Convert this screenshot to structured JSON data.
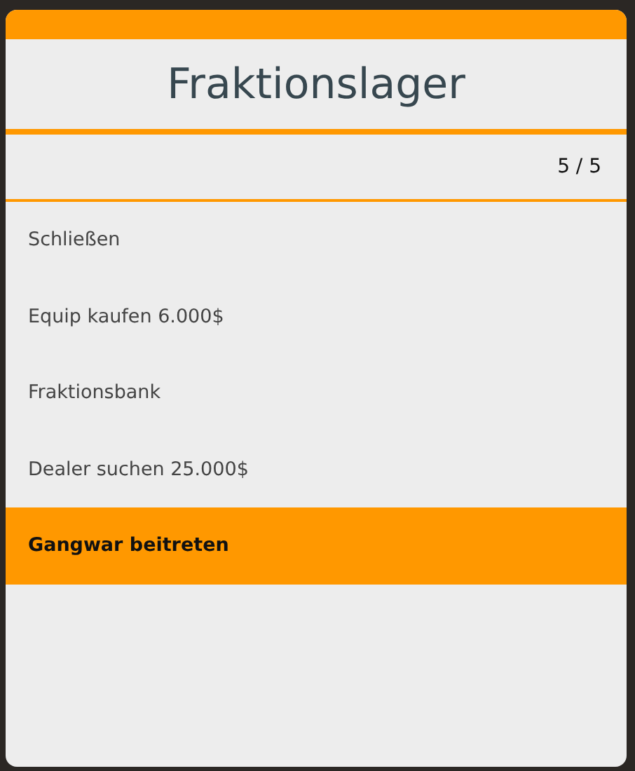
{
  "menu": {
    "title": "Fraktionslager",
    "counter": "5 / 5",
    "items": [
      {
        "label": "Schließen",
        "selected": false
      },
      {
        "label": "Equip kaufen 6.000$",
        "selected": false
      },
      {
        "label": "Fraktionsbank",
        "selected": false
      },
      {
        "label": "Dealer suchen 25.000$",
        "selected": false
      },
      {
        "label": "Gangwar beitreten",
        "selected": true
      }
    ]
  }
}
